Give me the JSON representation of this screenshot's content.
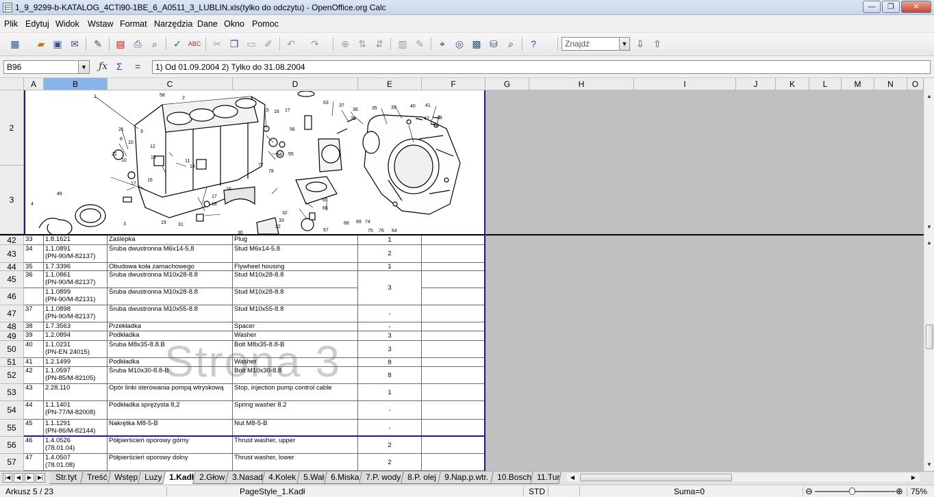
{
  "window": {
    "title": "1_9_9299-b-KATALOG_4CTi90-1BE_6_A0511_3_LUBLIN.xls(tylko do odczytu) - OpenOffice.org Calc"
  },
  "window_buttons": {
    "minimize": "—",
    "maximize": "❐",
    "close": "✕"
  },
  "menu": [
    "Plik",
    "Edytuj",
    "Widok",
    "Wstaw",
    "Format",
    "Narzędzia",
    "Dane",
    "Okno",
    "Pomoc"
  ],
  "toolbar": {
    "find_placeholder": "Znajdź"
  },
  "formula": {
    "cell_ref": "B96",
    "content": "1) Od 01.09.2004 2) Tylko do 31.08.2004"
  },
  "columns": [
    "A",
    "B",
    "C",
    "D",
    "E",
    "F",
    "G",
    "H",
    "I",
    "J",
    "K",
    "L",
    "M",
    "N",
    "O"
  ],
  "selected_column": "B",
  "image_rows": [
    "2",
    "3"
  ],
  "diagram_labels": [
    "1",
    "58",
    "2",
    "21",
    "6",
    "10",
    "21",
    "9",
    "12",
    "13",
    "10",
    "16",
    "17",
    "11",
    "15",
    "16",
    "17",
    "56",
    "14",
    "54",
    "55",
    "77",
    "78",
    "63",
    "37",
    "38",
    "36",
    "35",
    "39",
    "40",
    "41",
    "42",
    "48",
    "46",
    "4",
    "3",
    "16",
    "17",
    "18",
    "19",
    "31",
    "32",
    "33",
    "22",
    "30",
    "67",
    "68",
    "69",
    "74",
    "75",
    "76",
    "64",
    "65",
    "66"
  ],
  "rows": [
    {
      "row": "42",
      "a": "33",
      "b": [
        "1.8.1621"
      ],
      "c": "Zaślepka",
      "d": "Plug",
      "e": "1"
    },
    {
      "row": "43",
      "a": "34",
      "b": [
        "1.1.0891",
        "(PN-90/M-82137)"
      ],
      "c": "Śruba dwustronna M6x14-5,8",
      "d": "Stud M6x14-5.8",
      "e": "2"
    },
    {
      "row": "44",
      "a": "35",
      "b": [
        "1.7.3396"
      ],
      "c": "Obudowa koła zamachowego",
      "d": "Flywheel housing",
      "e": "1"
    },
    {
      "row": "45",
      "a": "36",
      "b": [
        "1.1.0861",
        "(PN-90/M-82137)"
      ],
      "c": "Śruba dwustronna M10x28-8.8",
      "d": "Stud M10x28-8.8",
      "e": "3"
    },
    {
      "row": "46",
      "a": "",
      "b": [
        "1.1.0899",
        "(PN-90/M-82131)"
      ],
      "c": "Śruba dwustronna M10x28-8.8",
      "d": "Stud M10x28-8.8",
      "e": ""
    },
    {
      "row": "47",
      "a": "37",
      "b": [
        "1.1.0898",
        "(PN-90/M-82137)"
      ],
      "c": "Śruba dwustronna M10x55-8.8",
      "d": "Stud M10x55-8.8",
      "e": "-"
    },
    {
      "row": "48",
      "a": "38",
      "b": [
        "1.7.3563"
      ],
      "c": "Przekładka",
      "d": "Spacer",
      "e": "-"
    },
    {
      "row": "49",
      "a": "39",
      "b": [
        "1.2.0894"
      ],
      "c": "Podkładka",
      "d": "Washer",
      "e": "3"
    },
    {
      "row": "50",
      "a": "40",
      "b": [
        "1.1.0231",
        "(PN-EN 24015)"
      ],
      "c": "Śruba M8x35-8.8.B",
      "d": "Bolt M8x35-8.8-B",
      "e": "3"
    },
    {
      "row": "51",
      "a": "41",
      "b": [
        "1.2.1499"
      ],
      "c": "Podkładka",
      "d": "Washer",
      "e": "8"
    },
    {
      "row": "52",
      "a": "42",
      "b": [
        "1.1.0597",
        "(PN-85/M-82105)"
      ],
      "c": "Śruba M10x30-8.8-B",
      "d": "Bolt M10x30-8.8",
      "e": "8"
    },
    {
      "row": "53",
      "a": "43",
      "b": [
        "2.28.110"
      ],
      "c": "Opór linki sterowania pompą wtryskową",
      "d": "Stop, injection pump control cable",
      "e": "1"
    },
    {
      "row": "54",
      "a": "44",
      "b": [
        "1.1.1401",
        "(PN-77/M-82008)"
      ],
      "c": "Podkładka sprężysta 8,2",
      "d": "Spring washer 8.2",
      "e": "-"
    },
    {
      "row": "55",
      "a": "45",
      "b": [
        "1.1.1291",
        "(PN-86/M-82144)"
      ],
      "c": "Nakrętka M8-5-B",
      "d": "Nut M8-5-B",
      "e": "-"
    },
    {
      "row": "56",
      "a": "46",
      "b": [
        "1.4.0526",
        "(78.01.04)"
      ],
      "c": "Półpierścień oporowy górny",
      "d": "Thrust washer, upper",
      "e": "2"
    },
    {
      "row": "57",
      "a": "47",
      "b": [
        "1.4.0507",
        "(78.01.08)"
      ],
      "c": "Półpierścień oporowy dolny",
      "d": "Thrust washer, lower",
      "e": "2"
    }
  ],
  "watermark": "Strona 3",
  "tab_nav": {
    "first": "|◀",
    "prev": "◀",
    "next": "▶",
    "last": "▶|"
  },
  "sheet_tabs": [
    "Str.tyt",
    "Treść",
    "Wstęp",
    "Luzy",
    "1.Kadł",
    "2.Głow",
    "3.Nasad",
    "4.Kolek",
    "5.Wał",
    "6.Miska",
    "7.P. wody",
    "8.P. olej",
    "9.Nap.p.wtr.",
    "10.Bosch",
    "11.Tur"
  ],
  "active_tab": "1.Kadł",
  "status": {
    "sheet": "Arkusz 5 / 23",
    "page_style": "PageStyle_1.Kadł",
    "mode": "STD",
    "sum": "Suma=0",
    "zoom": "75%",
    "zoom_minus": "⊖",
    "zoom_plus": "⊕",
    "zoom_fraction": 0.47
  }
}
